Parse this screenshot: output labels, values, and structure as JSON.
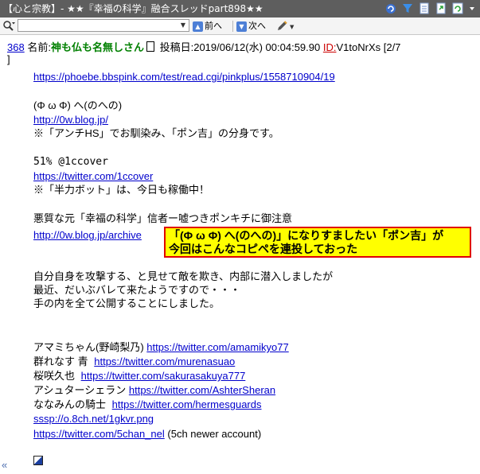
{
  "window": {
    "title": "【心と宗教】- ★★『幸福の科学』融合スレッドpart898★★"
  },
  "toolbar": {
    "search_value": "",
    "prev_label": "前へ",
    "next_label": "次へ"
  },
  "post": {
    "number": "368",
    "name_label": "名前:",
    "name": "神も仏も名無しさん",
    "posted_label": "投稿日:",
    "date": "2019/06/12(水) 00:04:59.90",
    "id_label": "ID:",
    "id": "V1toNrXs [2/7",
    "bracket_close": "]",
    "lines": [
      {
        "text": "https://phoebe.bbspink.com/test/read.cgi/pinkplus/1558710904/19",
        "kind": "link"
      },
      {
        "text": "(Φ ω Φ) へ(のへの)",
        "kind": "text"
      },
      {
        "text": "http://0w.blog.jp/",
        "kind": "link"
      },
      {
        "text": "※「アンチHS」でお馴染み、「ポン吉」の分身です。",
        "kind": "text"
      },
      {
        "text": "51% @1ccover",
        "kind": "mono"
      },
      {
        "text": "https://twitter.com/1ccover",
        "kind": "link"
      },
      {
        "text": "※「半力ボット」は、今日も稼働中！",
        "kind": "text"
      },
      {
        "text": "悪質な元「幸福の科学」信者ー嘘つきポンキチに御注意",
        "kind": "text"
      },
      {
        "text": "http://0w.blog.jp/archive",
        "kind": "link"
      },
      {
        "text": "自分自身を攻撃する、と見せて敵を欺き、内部に潜入しましたが",
        "kind": "text"
      },
      {
        "text": "最近、だいぶバレて来たようですので・・・",
        "kind": "text"
      },
      {
        "text": "手の内を全て公開することにしました。",
        "kind": "text"
      }
    ],
    "accounts": [
      {
        "name": "アマミちゃん(野崎梨乃)",
        "url": "https://twitter.com/amamikyo77"
      },
      {
        "name": "群れなす 青",
        "url": "https://twitter.com/murenasuao"
      },
      {
        "name": "桜咲久也",
        "url": "https://twitter.com/sakurasakuya777"
      },
      {
        "name": "アシュターシェラン",
        "url": "https://twitter.com/AshterSheran"
      },
      {
        "name": "ななみんの騎士",
        "url": "https://twitter.com/hermesguards"
      }
    ],
    "img_link": "sssp://o.8ch.net/1gkvr.png",
    "last_link": "https://twitter.com/5chan_nel",
    "last_note": "(5ch newer account)"
  },
  "callout": {
    "line1": "「(Φ ω Φ) へ(のへの)」になりすましたい「ポン吉」が",
    "line2": "今回はこんなコピペを連投しておった"
  },
  "footer": {
    "left_mark": "«"
  },
  "colors": {
    "titlebar": "#5e5e5e",
    "link": "#0000cc",
    "name": "#008000",
    "id": "#cc0000",
    "callout_bg": "#ffff00",
    "callout_border": "#e00000"
  }
}
